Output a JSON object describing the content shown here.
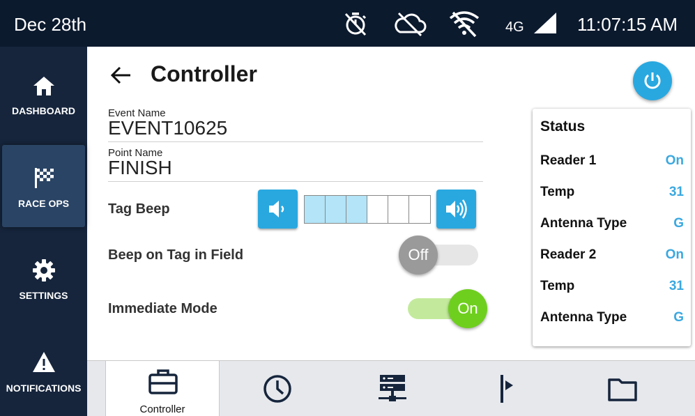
{
  "status_bar": {
    "date": "Dec 28th",
    "network": "4G",
    "time": "11:07:15 AM",
    "icons": [
      "stopwatch-off-icon",
      "cloud-off-icon",
      "wifi-off-icon",
      "cell-signal-icon"
    ]
  },
  "sidebar": {
    "items": [
      {
        "label": "DASHBOARD",
        "icon": "home-icon",
        "active": false
      },
      {
        "label": "RACE OPS",
        "icon": "checkered-flag-icon",
        "active": true
      },
      {
        "label": "SETTINGS",
        "icon": "gear-icon",
        "active": false
      },
      {
        "label": "NOTIFICATIONS",
        "icon": "warning-icon",
        "active": false
      }
    ]
  },
  "header": {
    "title": "Controller",
    "back_icon": "arrow-left-icon",
    "power_icon": "power-icon"
  },
  "form": {
    "event_name": {
      "label": "Event Name",
      "value": "EVENT10625"
    },
    "point_name": {
      "label": "Point Name",
      "value": "FINISH"
    },
    "tag_beep": {
      "label": "Tag Beep",
      "level": 3,
      "max": 6
    },
    "beep_on_tag": {
      "label": "Beep on Tag in Field",
      "state": "Off"
    },
    "immediate_mode": {
      "label": "Immediate Mode",
      "state": "On"
    }
  },
  "status": {
    "title": "Status",
    "rows": [
      {
        "key": "Reader 1",
        "value": "On"
      },
      {
        "key": "Temp",
        "value": "31"
      },
      {
        "key": "Antenna Type",
        "value": "G"
      },
      {
        "key": "Reader 2",
        "value": "On"
      },
      {
        "key": "Temp",
        "value": "31"
      },
      {
        "key": "Antenna Type",
        "value": "G"
      }
    ]
  },
  "bottom_nav": {
    "items": [
      {
        "label": "Controller",
        "icon": "briefcase-icon",
        "active": true
      },
      {
        "label": "",
        "icon": "clock-icon",
        "active": false
      },
      {
        "label": "",
        "icon": "server-network-icon",
        "active": false
      },
      {
        "label": "",
        "icon": "flag-marker-icon",
        "active": false
      },
      {
        "label": "",
        "icon": "folder-icon",
        "active": false
      }
    ]
  },
  "colors": {
    "status_bar_bg": "#0c1a2e",
    "sidebar_bg": "#16253c",
    "sidebar_active_bg": "#2a4465",
    "accent_blue": "#29a8e0",
    "status_value": "#3aa8e0",
    "toggle_on": "#6fcf1f",
    "toggle_off": "#9a9a9a"
  }
}
